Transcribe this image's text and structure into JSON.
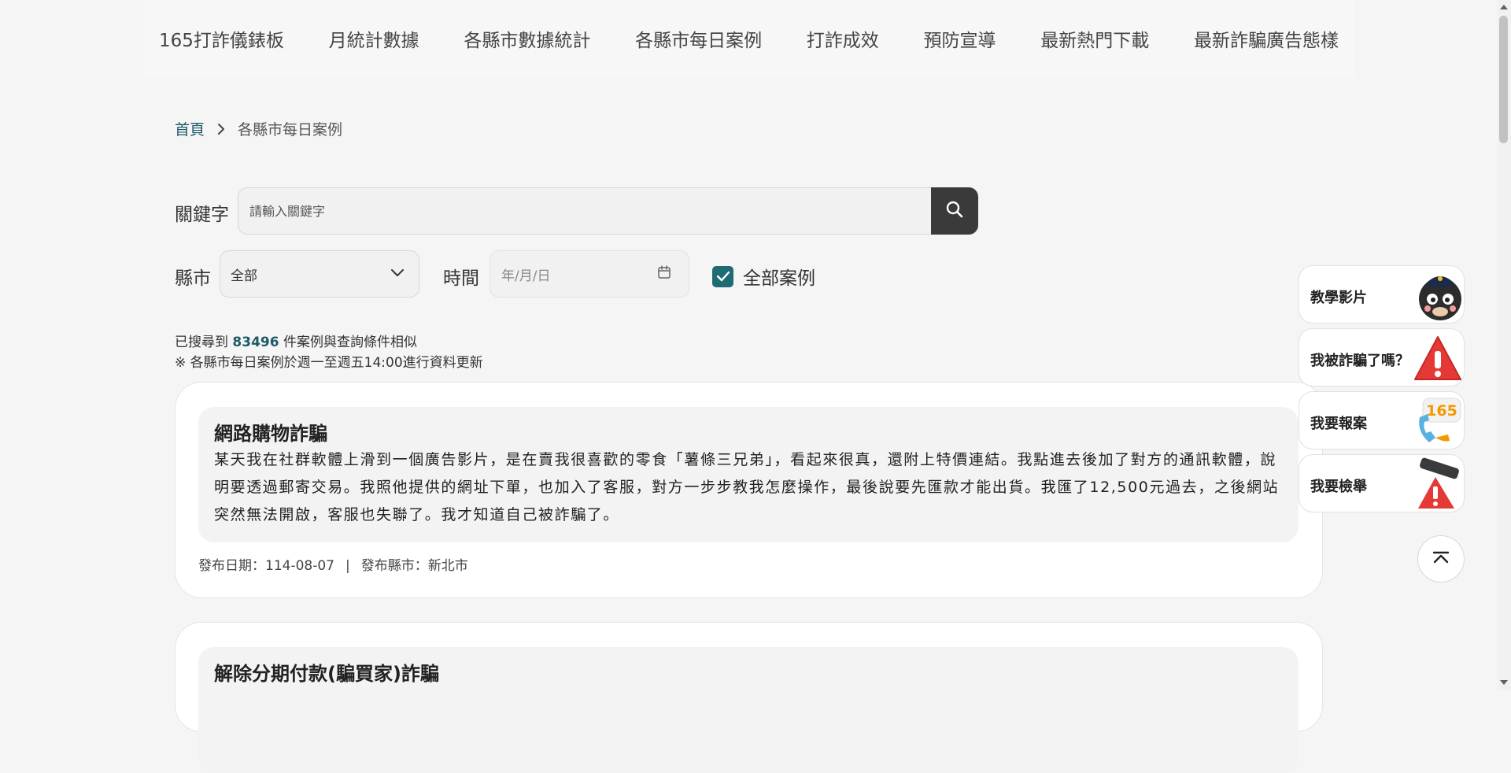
{
  "nav": {
    "items": [
      {
        "label": "165打詐儀錶板"
      },
      {
        "label": "月統計數據"
      },
      {
        "label": "各縣市數據統計"
      },
      {
        "label": "各縣市每日案例"
      },
      {
        "label": "打詐成效"
      },
      {
        "label": "預防宣導"
      },
      {
        "label": "最新熱門下載"
      },
      {
        "label": "最新詐騙廣告態樣"
      }
    ]
  },
  "breadcrumb": {
    "home": "首頁",
    "current": "各縣市每日案例"
  },
  "search": {
    "keyword_label": "關鍵字",
    "keyword_placeholder": "請輸入關鍵字",
    "keyword_value": "",
    "county_label": "縣市",
    "county_value": "全部",
    "time_label": "時間",
    "date_placeholder": "年/月/日",
    "all_cases_label": "全部案例",
    "all_cases_checked": true
  },
  "results": {
    "prefix": "已搜尋到",
    "count": "83496",
    "suffix": "件案例與查詢條件相似",
    "note": "※ 各縣市每日案例於週一至週五14:00進行資料更新"
  },
  "cases": [
    {
      "title": "網路購物詐騙",
      "body": "某天我在社群軟體上滑到一個廣告影片，是在賣我很喜歡的零食「薯條三兄弟」，看起來很真，還附上特價連結。我點進去後加了對方的通訊軟體，說明要透過郵寄交易。我照他提供的網址下單，也加入了客服，對方一步步教我怎麼操作，最後說要先匯款才能出貨。我匯了12,500元過去，之後網站突然無法開啟，客服也失聯了。我才知道自己被詐騙了。",
      "date_text": "發布日期：114-08-07",
      "separator": "|",
      "county_text": "發布縣市：新北市"
    },
    {
      "title": "解除分期付款(騙買家)詐騙"
    }
  ],
  "side_buttons": [
    {
      "label": "教學影片",
      "icon": "mascot-icon"
    },
    {
      "label": "我被詐騙了嗎？",
      "icon": "warning-triangle-icon"
    },
    {
      "label": "我要報案",
      "icon": "phone-165-icon"
    },
    {
      "label": "我要檢舉",
      "icon": "report-warning-icon"
    }
  ],
  "badge_text": "165",
  "colors": {
    "accent": "#1f5a66",
    "checkbox": "#1f6b75",
    "search_button": "#3a3a3a",
    "warning_red": "#e53935",
    "badge_orange": "#f39800"
  }
}
